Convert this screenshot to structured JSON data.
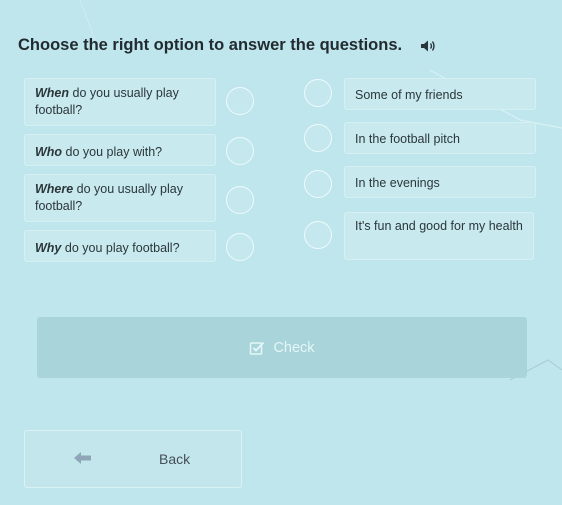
{
  "instructions": "Choose the right option to answer the questions.",
  "audio_icon": "speaker-icon",
  "questions": [
    {
      "bold": "When",
      "rest": " do you usually play football?"
    },
    {
      "bold": "Who",
      "rest": " do you play with?"
    },
    {
      "bold": "Where",
      "rest": " do you usually play football?"
    },
    {
      "bold": "Why",
      "rest": " do you play football?"
    }
  ],
  "answers": [
    "Some of my friends",
    "In the football pitch",
    "In the evenings",
    "It's fun and good for my health"
  ],
  "check_button": {
    "label": "Check",
    "icon": "checkbox-icon"
  },
  "back_button": {
    "label": "Back",
    "icon": "arrow-left-icon"
  },
  "colors": {
    "background": "#bfe6ec",
    "check_disabled": "#a9d4da"
  }
}
